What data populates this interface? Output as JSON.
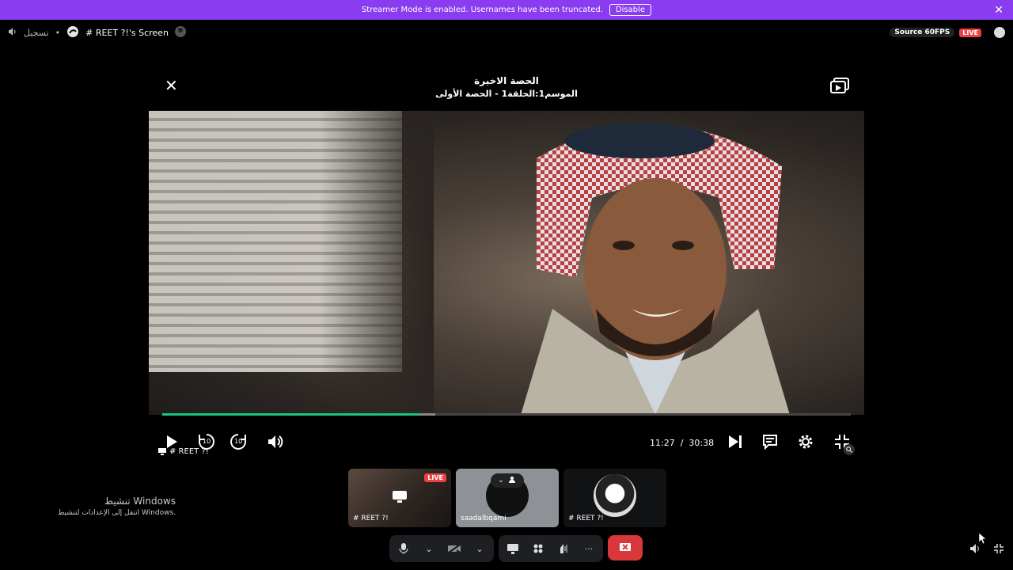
{
  "banner": {
    "message": "Streamer Mode is enabled. Usernames have been truncated.",
    "disable_label": "Disable",
    "close_glyph": "✕",
    "color": "#8a3cf0"
  },
  "topbar": {
    "left_label": "تسجيل",
    "screen_title": "# REET ?!'s Screen",
    "source_label": "Source 60FPS",
    "live_label": "LIVE"
  },
  "player": {
    "title": "الحصة الاخيرة",
    "subtitle": "الموسم1:الحلقة1 - الحصة الأولى",
    "close_glyph": "✕",
    "current_time": "11:27",
    "separator": "/",
    "duration": "30:38",
    "progress_fraction": 0.374,
    "buffered_fraction": 0.397,
    "rewind_label": "10",
    "forward_label": "10",
    "overlay_user": "# REET ?!",
    "accent": "#1bc47d"
  },
  "tiles": [
    {
      "label": "# REET ?!",
      "live": "LIVE"
    },
    {
      "label": "saadalbqami"
    },
    {
      "label": "# REET ?!"
    }
  ],
  "watermark": {
    "line1": "تنشيط Windows",
    "line2": "انتقل إلى الإعدادات لتنشيط Windows."
  },
  "callbar": {
    "more_glyph": "···",
    "leave_color": "#da373c"
  }
}
